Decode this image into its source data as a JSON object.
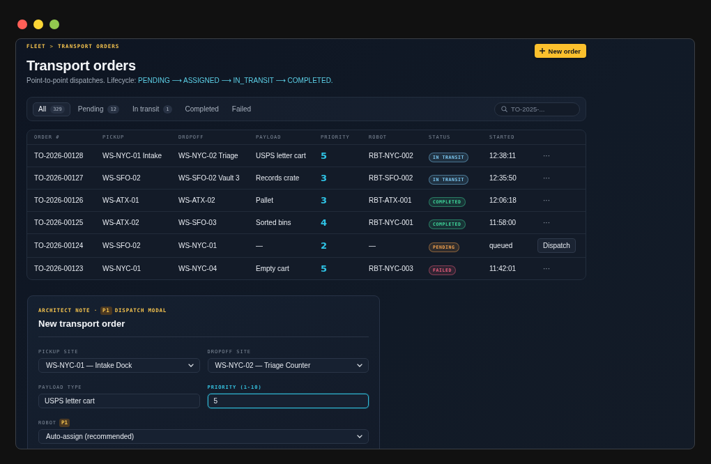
{
  "breadcrumb": {
    "items": [
      "FLEET",
      "TRANSPORT ORDERS"
    ],
    "separator": ">"
  },
  "header": {
    "title": "Transport orders",
    "subtitle": "Point-to-point dispatches. Lifecycle:",
    "lifecycle": "PENDING ⟶ ASSIGNED ⟶ IN_TRANSIT ⟶ COMPLETED.",
    "new_order_button": "New order"
  },
  "filters": {
    "tabs": [
      {
        "label": "All",
        "count": "329",
        "selected": true
      },
      {
        "label": "Pending",
        "count": "12",
        "selected": false
      },
      {
        "label": "In transit",
        "count": "1",
        "selected": false
      },
      {
        "label": "Completed",
        "selected": false
      },
      {
        "label": "Failed",
        "selected": false
      }
    ],
    "search": {
      "placeholder": "TO-2025-..."
    }
  },
  "table": {
    "columns": [
      "ORDER #",
      "PICKUP",
      "DROPOFF",
      "PAYLOAD",
      "PRIORITY",
      "ROBOT",
      "STATUS",
      "STARTED"
    ],
    "rows": [
      {
        "order": "TO-2026-00128",
        "pickup": "WS-NYC-01 Intake",
        "dropoff": "WS-NYC-02 Triage",
        "payload": "USPS letter cart",
        "priority": "5",
        "robot": "RBT-NYC-002",
        "status": {
          "label": "IN TRANSIT",
          "color": "#7cc8f2"
        },
        "started": "12:38:11",
        "action": {
          "kind": "menu",
          "label": "···"
        }
      },
      {
        "order": "TO-2026-00127",
        "pickup": "WS-SFO-02",
        "dropoff": "WS-SFO-02 Vault 3",
        "payload": "Records crate",
        "priority": "3",
        "robot": "RBT-SFO-002",
        "status": {
          "label": "IN TRANSIT",
          "color": "#7cc8f2"
        },
        "started": "12:35:50",
        "action": {
          "kind": "menu",
          "label": "···"
        }
      },
      {
        "order": "TO-2026-00126",
        "pickup": "WS-ATX-01",
        "dropoff": "WS-ATX-02",
        "payload": "Pallet",
        "priority": "3",
        "robot": "RBT-ATX-001",
        "status": {
          "label": "COMPLETED",
          "color": "#3fd69a"
        },
        "started": "12:06:18",
        "action": {
          "kind": "menu",
          "label": "···"
        }
      },
      {
        "order": "TO-2026-00125",
        "pickup": "WS-ATX-02",
        "dropoff": "WS-SFO-03",
        "payload": "Sorted bins",
        "priority": "4",
        "robot": "RBT-NYC-001",
        "status": {
          "label": "COMPLETED",
          "color": "#3fd69a"
        },
        "started": "11:58:00",
        "action": {
          "kind": "menu",
          "label": "···"
        }
      },
      {
        "order": "TO-2026-00124",
        "pickup": "WS-SFO-02",
        "dropoff": "WS-NYC-01",
        "payload": "—",
        "priority": "2",
        "robot": "—",
        "status": {
          "label": "PENDING",
          "color": "#f0a04e"
        },
        "started": "queued",
        "action": {
          "kind": "button",
          "label": "Dispatch"
        }
      },
      {
        "order": "TO-2026-00123",
        "pickup": "WS-NYC-01",
        "dropoff": "WS-NYC-04",
        "payload": "Empty cart",
        "priority": "5",
        "robot": "RBT-NYC-003",
        "status": {
          "label": "FAILED",
          "color": "#ee5f7e"
        },
        "started": "11:42:01",
        "action": {
          "kind": "menu",
          "label": "···"
        }
      }
    ]
  },
  "modal": {
    "note": {
      "label": "ARCHITECT NOTE ·",
      "badge": "P1",
      "topic": "DISPATCH MODAL"
    },
    "title": "New transport order",
    "rows": [
      [
        {
          "kind": "select",
          "label": "PICKUP SITE",
          "value": "WS-NYC-01 — Intake Dock",
          "focused": false
        },
        {
          "kind": "select",
          "label": "DROPOFF SITE",
          "value": "WS-NYC-02 — Triage Counter",
          "focused": false
        }
      ],
      [
        {
          "kind": "input",
          "label": "PAYLOAD TYPE",
          "value": "USPS letter cart",
          "focused": false
        },
        {
          "kind": "input",
          "label": "PRIORITY (1-10)",
          "value": "5",
          "focused": true
        }
      ],
      [
        {
          "kind": "select",
          "label": "ROBOT",
          "badge": "P1",
          "value": "Auto-assign (recommended)",
          "focused": false
        }
      ]
    ]
  }
}
